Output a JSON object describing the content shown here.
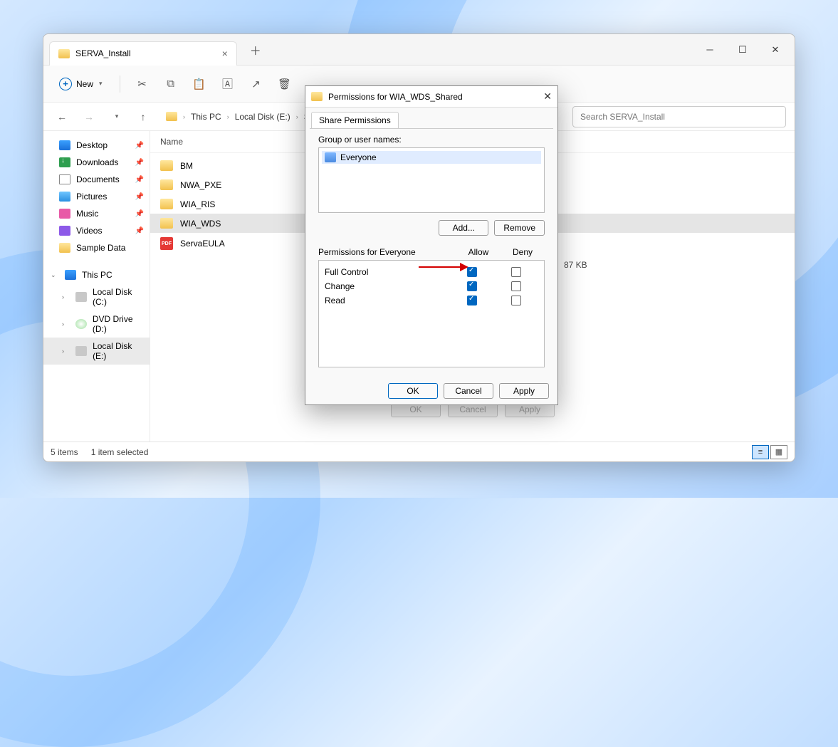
{
  "explorer": {
    "tab_title": "SERVA_Install",
    "new_label": "New",
    "breadcrumb": [
      "This PC",
      "Local Disk (E:)",
      "SERVA_"
    ],
    "search_placeholder": "Search SERVA_Install",
    "columns": {
      "name": "Name"
    },
    "sidebar": {
      "quick": [
        {
          "icon": "ic-desktop",
          "label": "Desktop"
        },
        {
          "icon": "ic-down",
          "label": "Downloads"
        },
        {
          "icon": "ic-doc",
          "label": "Documents"
        },
        {
          "icon": "ic-pic",
          "label": "Pictures"
        },
        {
          "icon": "ic-music",
          "label": "Music"
        },
        {
          "icon": "ic-video",
          "label": "Videos"
        },
        {
          "icon": "ic-folder",
          "label": "Sample Data"
        }
      ],
      "thispc_label": "This PC",
      "drives": [
        {
          "icon": "ic-disk",
          "label": "Local Disk (C:)"
        },
        {
          "icon": "ic-dvd",
          "label": "DVD Drive (D:)"
        },
        {
          "icon": "ic-disk",
          "label": "Local Disk (E:)",
          "selected": true
        }
      ]
    },
    "files": [
      {
        "type": "folder",
        "name": "BM"
      },
      {
        "type": "folder",
        "name": "NWA_PXE"
      },
      {
        "type": "folder",
        "name": "WIA_RIS"
      },
      {
        "type": "folder",
        "name": "WIA_WDS",
        "selected": true
      },
      {
        "type": "pdf",
        "name": "ServaEULA",
        "size": "87 KB"
      }
    ],
    "status": {
      "count": "5 items",
      "selected": "1 item selected"
    }
  },
  "dialog": {
    "title": "Permissions for WIA_WDS_Shared",
    "tab": "Share Permissions",
    "group_label": "Group or user names:",
    "groups": [
      "Everyone"
    ],
    "add": "Add...",
    "remove": "Remove",
    "perm_label": "Permissions for Everyone",
    "allow": "Allow",
    "deny": "Deny",
    "perms": [
      {
        "name": "Full Control",
        "allow": true,
        "deny": false
      },
      {
        "name": "Change",
        "allow": true,
        "deny": false
      },
      {
        "name": "Read",
        "allow": true,
        "deny": false
      }
    ],
    "ok": "OK",
    "cancel": "Cancel",
    "apply": "Apply"
  },
  "under": {
    "ok": "OK",
    "cancel": "Cancel",
    "apply": "Apply"
  }
}
